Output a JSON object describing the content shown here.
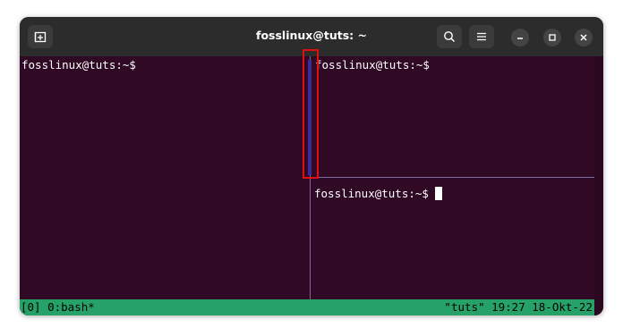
{
  "window": {
    "title": "fosslinux@tuts: ~"
  },
  "titlebar": {
    "new_tab_icon": "new-tab-icon",
    "search_icon": "search-icon",
    "menu_icon": "hamburger-menu-icon",
    "minimize_icon": "minimize-icon",
    "maximize_icon": "maximize-icon",
    "close_icon": "close-icon"
  },
  "panes": {
    "left": {
      "prompt": "fosslinux@tuts:~$"
    },
    "top_right": {
      "prompt": "fosslinux@tuts:~$"
    },
    "bottom_right": {
      "prompt": "fosslinux@tuts:~$ "
    }
  },
  "tmux_status": {
    "left": "[0] 0:bash*",
    "right": "\"tuts\" 19:27 18-Okt-22"
  },
  "colors": {
    "terminal_bg": "#300a24",
    "titlebar_bg": "#2c2c2c",
    "status_bg": "#26a269",
    "pane_border": "#7a6aa6",
    "active_pane_border": "#3a2a9a",
    "annotation_highlight": "#e01010"
  }
}
